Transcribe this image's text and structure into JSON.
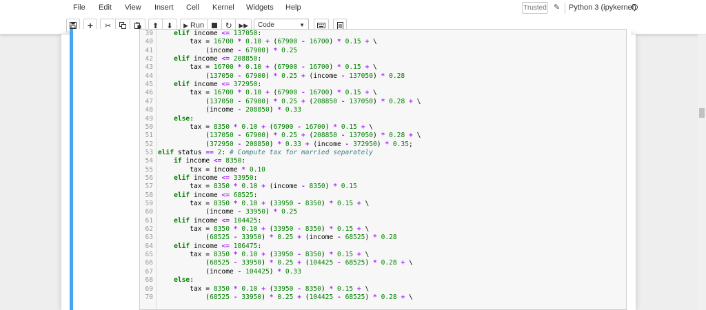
{
  "menubar": {
    "items": [
      "File",
      "Edit",
      "View",
      "Insert",
      "Cell",
      "Kernel",
      "Widgets",
      "Help"
    ],
    "trusted": "Trusted",
    "kernel_name": "Python 3 (ipykernel)"
  },
  "toolbar": {
    "run_label": "Run",
    "cell_type": "Code"
  },
  "code_lines": [
    {
      "n": "39",
      "code": "    elif income <= 137050:"
    },
    {
      "n": "40",
      "code": "        tax = 16700 * 0.10 + (67900 - 16700) * 0.15 + \\"
    },
    {
      "n": "41",
      "code": "            (income - 67900) * 0.25"
    },
    {
      "n": "42",
      "code": "    elif income <= 208850:"
    },
    {
      "n": "43",
      "code": "        tax = 16700 * 0.10 + (67900 - 16700) * 0.15 + \\"
    },
    {
      "n": "44",
      "code": "            (137050 - 67900) * 0.25 + (income - 137050) * 0.28"
    },
    {
      "n": "45",
      "code": "    elif income <= 372950:"
    },
    {
      "n": "46",
      "code": "        tax = 16700 * 0.10 + (67900 - 16700) * 0.15 + \\"
    },
    {
      "n": "47",
      "code": "            (137050 - 67900) * 0.25 + (208850 - 137050) * 0.28 + \\"
    },
    {
      "n": "48",
      "code": "            (income - 208850) * 0.33"
    },
    {
      "n": "49",
      "code": "    else:"
    },
    {
      "n": "50",
      "code": "        tax = 8350 * 0.10 + (67900 - 16700) * 0.15 + \\"
    },
    {
      "n": "51",
      "code": "            (137050 - 67900) * 0.25 + (208850 - 137050) * 0.28 + \\"
    },
    {
      "n": "52",
      "code": "            (372950 - 208850) * 0.33 + (income - 372950) * 0.35;"
    },
    {
      "n": "53",
      "code": "elif status == 2: # Compute tax for married separately"
    },
    {
      "n": "54",
      "code": "    if income <= 8350:"
    },
    {
      "n": "55",
      "code": "        tax = income * 0.10"
    },
    {
      "n": "56",
      "code": "    elif income <= 33950:"
    },
    {
      "n": "57",
      "code": "        tax = 8350 * 0.10 + (income - 8350) * 0.15"
    },
    {
      "n": "58",
      "code": "    elif income <= 68525:"
    },
    {
      "n": "59",
      "code": "        tax = 8350 * 0.10 + (33950 - 8350) * 0.15 + \\"
    },
    {
      "n": "60",
      "code": "            (income - 33950) * 0.25"
    },
    {
      "n": "61",
      "code": "    elif income <= 104425:"
    },
    {
      "n": "62",
      "code": "        tax = 8350 * 0.10 + (33950 - 8350) * 0.15 + \\"
    },
    {
      "n": "63",
      "code": "            (68525 - 33950) * 0.25 + (income - 68525) * 0.28"
    },
    {
      "n": "64",
      "code": "    elif income <= 186475:"
    },
    {
      "n": "65",
      "code": "        tax = 8350 * 0.10 + (33950 - 8350) * 0.15 + \\"
    },
    {
      "n": "66",
      "code": "            (68525 - 33950) * 0.25 + (104425 - 68525) * 0.28 + \\"
    },
    {
      "n": "67",
      "code": "            (income - 104425) * 0.33"
    },
    {
      "n": "68",
      "code": "    else:"
    },
    {
      "n": "69",
      "code": "        tax = 8350 * 0.10 + (33950 - 8350) * 0.15 + \\"
    },
    {
      "n": "70",
      "code": "            (68525 - 33950) * 0.25 + (104425 - 68525) * 0.28 + \\"
    }
  ],
  "colors": {
    "cell_accent": "#42a5f5",
    "keyword": "#008000",
    "operator": "#aa22ff",
    "number": "#008000",
    "comment": "#408080"
  }
}
